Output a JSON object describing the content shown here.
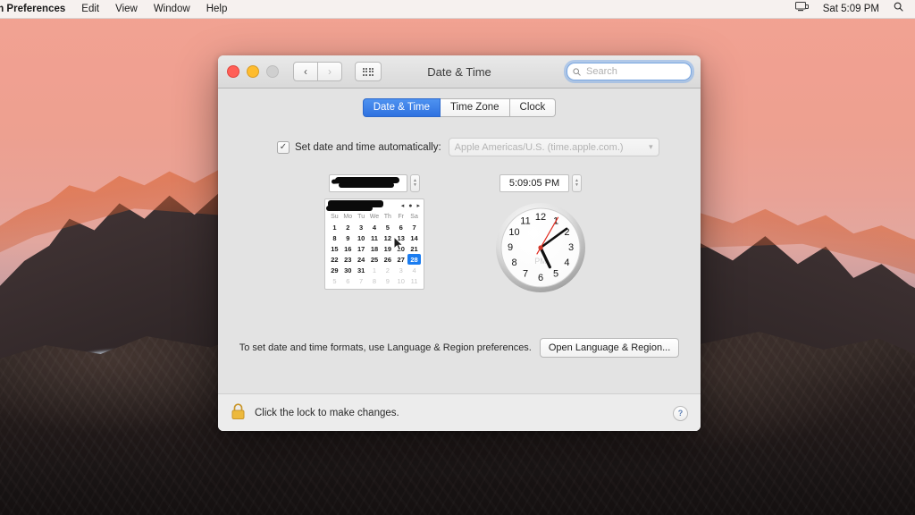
{
  "menubar": {
    "app_name": "m Preferences",
    "items": [
      "Edit",
      "View",
      "Window",
      "Help"
    ],
    "right": {
      "display_icon": "display-icon",
      "clock": "Sat 5:09 PM",
      "spotlight_icon": "search-icon"
    }
  },
  "window": {
    "title": "Date & Time",
    "traffic_lights": [
      "close",
      "minimize",
      "zoom"
    ],
    "nav": {
      "back": "‹",
      "forward": "›",
      "show_all": "grid-icon"
    },
    "search": {
      "placeholder": "Search",
      "value": ""
    }
  },
  "tabs": [
    {
      "label": "Date & Time",
      "active": true
    },
    {
      "label": "Time Zone",
      "active": false
    },
    {
      "label": "Clock",
      "active": false
    }
  ],
  "auto": {
    "checkbox_checked": true,
    "check_glyph": "✓",
    "label": "Set date and time automatically:",
    "server_value": "Apple Americas/U.S. (time.apple.com.)",
    "chevron": "▾"
  },
  "date": {
    "field_value": "",
    "field_redacted": true,
    "month_label": "",
    "month_redacted": true,
    "nav": {
      "prev": "◂",
      "today": "●",
      "next": "▸"
    },
    "weekdays": [
      "Su",
      "Mo",
      "Tu",
      "We",
      "Th",
      "Fr",
      "Sa"
    ],
    "weeks": [
      [
        {
          "n": "1"
        },
        {
          "n": "2"
        },
        {
          "n": "3"
        },
        {
          "n": "4"
        },
        {
          "n": "5"
        },
        {
          "n": "6"
        },
        {
          "n": "7"
        }
      ],
      [
        {
          "n": "8"
        },
        {
          "n": "9"
        },
        {
          "n": "10"
        },
        {
          "n": "11"
        },
        {
          "n": "12"
        },
        {
          "n": "13"
        },
        {
          "n": "14"
        }
      ],
      [
        {
          "n": "15"
        },
        {
          "n": "16"
        },
        {
          "n": "17"
        },
        {
          "n": "18"
        },
        {
          "n": "19"
        },
        {
          "n": "20"
        },
        {
          "n": "21"
        }
      ],
      [
        {
          "n": "22"
        },
        {
          "n": "23"
        },
        {
          "n": "24"
        },
        {
          "n": "25"
        },
        {
          "n": "26"
        },
        {
          "n": "27"
        },
        {
          "n": "28",
          "selected": true
        }
      ],
      [
        {
          "n": "29"
        },
        {
          "n": "30"
        },
        {
          "n": "31"
        },
        {
          "n": "1",
          "muted": true
        },
        {
          "n": "2",
          "muted": true
        },
        {
          "n": "3",
          "muted": true
        },
        {
          "n": "4",
          "muted": true
        }
      ],
      [
        {
          "n": "5",
          "muted": true
        },
        {
          "n": "6",
          "muted": true
        },
        {
          "n": "7",
          "muted": true
        },
        {
          "n": "8",
          "muted": true
        },
        {
          "n": "9",
          "muted": true
        },
        {
          "n": "10",
          "muted": true
        },
        {
          "n": "11",
          "muted": true
        }
      ]
    ]
  },
  "time": {
    "field_value": "5:09:05 PM",
    "clock": {
      "hour_numbers": [
        "12",
        "1",
        "2",
        "3",
        "4",
        "5",
        "6",
        "7",
        "8",
        "9",
        "10",
        "11"
      ],
      "meridiem_label": "PM",
      "hour_angle_deg": 154.5,
      "minute_angle_deg": 54,
      "second_angle_deg": 30,
      "second_hand_color": "#e02a1e"
    }
  },
  "formats": {
    "note": "To set date and time formats, use Language & Region preferences.",
    "button_label": "Open Language & Region..."
  },
  "footer": {
    "lock_icon": "lock-closed-icon",
    "lock_text": "Click the lock to make changes.",
    "help_label": "?"
  },
  "colors": {
    "accent_blue": "#2f72e0",
    "selected_day": "#1a7cf0",
    "lock_gold": "#edb93c",
    "window_body": "#e3e3e3"
  }
}
